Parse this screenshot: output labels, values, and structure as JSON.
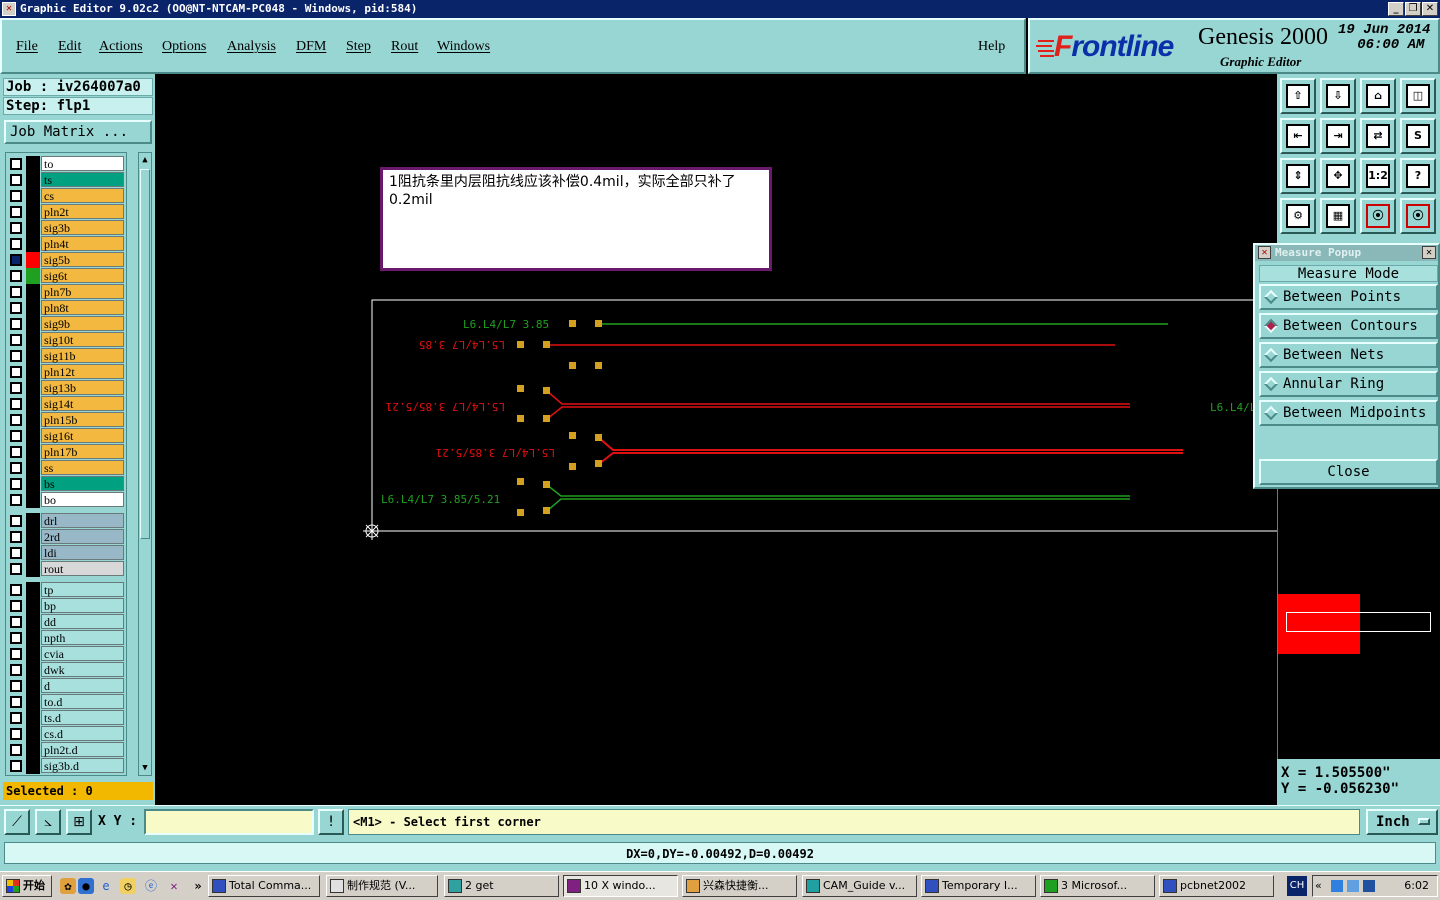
{
  "window": {
    "title": "Graphic Editor 9.02c2  (OO@NT-NTCAM-PC048 - Windows, pid:584)"
  },
  "menu": {
    "items": [
      "File",
      "Edit",
      "Actions",
      "Options",
      "Analysis",
      "DFM",
      "Step",
      "Rout",
      "Windows"
    ],
    "help": "Help"
  },
  "brand": {
    "logo_f": "F",
    "logo_rest": "rontline",
    "product": "Genesis 2000",
    "subtitle": "Graphic Editor",
    "date": "19 Jun 2014",
    "time": "06:00 AM"
  },
  "job": {
    "job_label": "Job : iv264007a0",
    "step_label": "Step: flp1",
    "matrix_button": "Job Matrix ...",
    "selected": "Selected : 0"
  },
  "layers": [
    {
      "name": "to",
      "color": "#ffffff",
      "swatch": "#000000"
    },
    {
      "name": "ts",
      "color": "#00a080",
      "swatch": "#000000"
    },
    {
      "name": "cs",
      "color": "#f2b840",
      "swatch": "#000000"
    },
    {
      "name": "pln2t",
      "color": "#f2b840",
      "swatch": "#000000"
    },
    {
      "name": "sig3b",
      "color": "#f2b840",
      "swatch": "#000000"
    },
    {
      "name": "pln4t",
      "color": "#f2b840",
      "swatch": "#000000"
    },
    {
      "name": "sig5b",
      "color": "#f2b840",
      "swatch": "#ff0000",
      "checked": true
    },
    {
      "name": "sig6t",
      "color": "#f2b840",
      "swatch": "#20a020"
    },
    {
      "name": "pln7b",
      "color": "#f2b840",
      "swatch": "#000000"
    },
    {
      "name": "pln8t",
      "color": "#f2b840",
      "swatch": "#000000"
    },
    {
      "name": "sig9b",
      "color": "#f2b840",
      "swatch": "#000000"
    },
    {
      "name": "sig10t",
      "color": "#f2b840",
      "swatch": "#000000"
    },
    {
      "name": "sig11b",
      "color": "#f2b840",
      "swatch": "#000000"
    },
    {
      "name": "pln12t",
      "color": "#f2b840",
      "swatch": "#000000"
    },
    {
      "name": "sig13b",
      "color": "#f2b840",
      "swatch": "#000000"
    },
    {
      "name": "sig14t",
      "color": "#f2b840",
      "swatch": "#000000"
    },
    {
      "name": "pln15b",
      "color": "#f2b840",
      "swatch": "#000000"
    },
    {
      "name": "sig16t",
      "color": "#f2b840",
      "swatch": "#000000"
    },
    {
      "name": "pln17b",
      "color": "#f2b840",
      "swatch": "#000000"
    },
    {
      "name": "ss",
      "color": "#f2b840",
      "swatch": "#000000"
    },
    {
      "name": "bs",
      "color": "#00a080",
      "swatch": "#000000"
    },
    {
      "name": "bo",
      "color": "#ffffff",
      "swatch": "#000000"
    },
    {
      "name": "drl",
      "color": "#98b8c8",
      "swatch": "#000000",
      "gap": true
    },
    {
      "name": "2rd",
      "color": "#98b8c8",
      "swatch": "#000000"
    },
    {
      "name": "ldi",
      "color": "#98b8c8",
      "swatch": "#000000"
    },
    {
      "name": "rout",
      "color": "#d8d8d8",
      "swatch": "#000000"
    },
    {
      "name": "tp",
      "color": "#a8e0de",
      "swatch": "#000000",
      "gap": true
    },
    {
      "name": "bp",
      "color": "#a8e0de",
      "swatch": "#000000"
    },
    {
      "name": "dd",
      "color": "#a8e0de",
      "swatch": "#000000"
    },
    {
      "name": "npth",
      "color": "#a8e0de",
      "swatch": "#000000"
    },
    {
      "name": "cvia",
      "color": "#a8e0de",
      "swatch": "#000000"
    },
    {
      "name": "dwk",
      "color": "#a8e0de",
      "swatch": "#000000"
    },
    {
      "name": "d",
      "color": "#a8e0de",
      "swatch": "#000000"
    },
    {
      "name": "to.d",
      "color": "#a8e0de",
      "swatch": "#000000"
    },
    {
      "name": "ts.d",
      "color": "#a8e0de",
      "swatch": "#000000"
    },
    {
      "name": "cs.d",
      "color": "#a8e0de",
      "swatch": "#000000"
    },
    {
      "name": "pln2t.d",
      "color": "#a8e0de",
      "swatch": "#000000"
    },
    {
      "name": "sig3b.d",
      "color": "#a8e0de",
      "swatch": "#000000"
    }
  ],
  "note": {
    "text": "1阻抗条里内层阻抗线应该补偿0.4mil，实际全部只补了0.2mil"
  },
  "canvas_labels": {
    "l1": "L6.L4/L7 3.85",
    "l2": "L5.L4/L7 3.85",
    "l3": "L5.L4/L7 3.85/5.21",
    "l4": "L5.L4/L7 3.85/5.21",
    "l5": "L6.L4/L7 3.85/5.21",
    "l6": "L6.L4/L"
  },
  "toolbar_icons": [
    "home-top-icon",
    "home-bottom-icon",
    "home-icon",
    "panel-icon",
    "left-icon",
    "right-icon",
    "swap-icon",
    "s-icon",
    "fit-vertical-icon",
    "fit-all-icon",
    "scale-icon",
    "help-icon",
    "tools-icon",
    "grid-icon",
    "layer-red-icon",
    "layer-red2-icon"
  ],
  "toolbar_text": {
    "scale": "1:2",
    "help": "?"
  },
  "measure": {
    "title": "Measure Popup",
    "mode": "Measure Mode",
    "options": [
      "Between Points",
      "Between Contours",
      "Between Nets",
      "Annular Ring",
      "Between Midpoints"
    ],
    "selected": 1,
    "close": "Close"
  },
  "coords": {
    "x": "X  =  1.505500\"",
    "y": "Y  = -0.056230\""
  },
  "cmd": {
    "xy_label": "X Y :",
    "xy_value": "",
    "prompt": "<M1> - Select first corner",
    "unit": "Inch",
    "excl": "!"
  },
  "status": {
    "text": "DX=0,DY=-0.00492,D=0.00492"
  },
  "taskbar": {
    "start": "开始",
    "tasks": [
      "Total Comma...",
      "制作规范 (V...",
      "2 get",
      "10 X windo...",
      "兴森快捷衡...",
      "CAM_Guide v...",
      "Temporary I...",
      "3 Microsof...",
      "pcbnet2002"
    ],
    "lang": "CH",
    "clock": "6:02"
  },
  "colors": {
    "bg": "#98d6d4",
    "accent_red": "#ff0000",
    "trace_green": "#20a020",
    "pad_gold": "#d4a020"
  }
}
